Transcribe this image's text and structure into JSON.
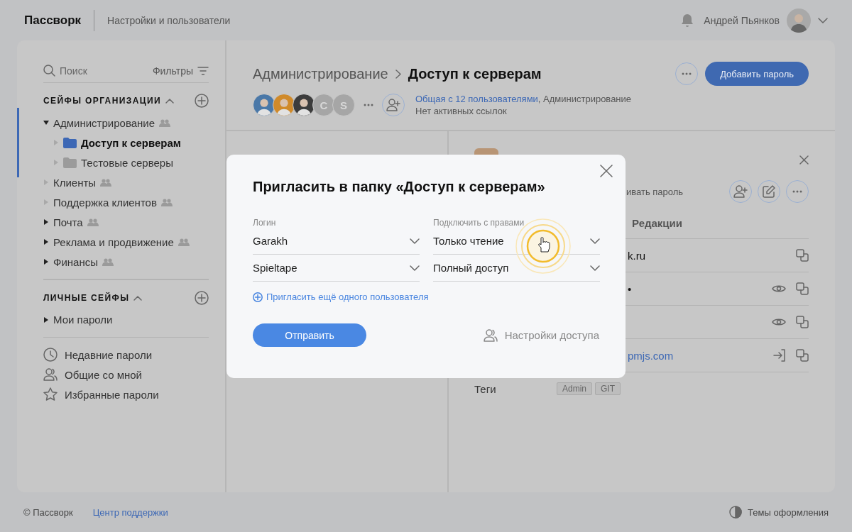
{
  "header": {
    "logo": "Пассворк",
    "section": "Настройки и пользователи",
    "user_name": "Андрей Пьянков"
  },
  "sidebar": {
    "search": {
      "placeholder": "Поиск"
    },
    "filters": "Фильтры",
    "org_vaults": {
      "title": "СЕЙФЫ ОРГАНИЗАЦИИ",
      "expanded": true,
      "items": [
        {
          "label": "Администрирование",
          "expanded": true,
          "empty": false,
          "shared": true,
          "selected": true,
          "children": [
            {
              "label": "Доступ к серверам",
              "expanded": false,
              "empty": true,
              "shared": false,
              "selected": true
            },
            {
              "label": "Тестовые серверы",
              "expanded": false,
              "empty": true,
              "shared": false,
              "selected": false
            }
          ]
        },
        {
          "label": "Клиенты",
          "expanded": false,
          "empty": true,
          "shared": true,
          "selected": false
        },
        {
          "label": "Поддержка клиентов",
          "expanded": false,
          "empty": true,
          "shared": true,
          "selected": false
        },
        {
          "label": "Почта",
          "expanded": false,
          "empty": false,
          "shared": true,
          "selected": false
        },
        {
          "label": "Реклама и продвижение",
          "expanded": false,
          "empty": false,
          "shared": true,
          "selected": false
        },
        {
          "label": "Финансы",
          "expanded": false,
          "empty": false,
          "shared": true,
          "selected": false
        }
      ]
    },
    "personal_vaults": {
      "title": "ЛИЧНЫЕ СЕЙФЫ",
      "expanded": true,
      "items": [
        {
          "label": "Мои пароли",
          "expanded": false,
          "empty": false,
          "shared": false,
          "selected": false
        }
      ]
    },
    "links": [
      {
        "kind": "recent",
        "label": "Недавние пароли"
      },
      {
        "kind": "shared",
        "label": "Общие со мной"
      },
      {
        "kind": "favorites",
        "label": "Избранные пароли"
      }
    ]
  },
  "folder": {
    "breadcrumb": [
      "Администрирование",
      "Доступ к серверам"
    ],
    "add_button": "Добавить пароль",
    "members": [
      {
        "kind": "photo",
        "color": "#4a78a8"
      },
      {
        "kind": "photo",
        "color": "#d08a2a"
      },
      {
        "kind": "photo",
        "color": "#3c3c3c"
      },
      {
        "kind": "letter",
        "label": "C"
      },
      {
        "kind": "letter",
        "label": "S"
      }
    ],
    "shared_link": "Общая с 12 пользователями",
    "shared_rest": ", Администрирование",
    "links_status": "Нет активных ссылок"
  },
  "detail": {
    "hint": "ивать пароль",
    "tab": "Редакции",
    "rows": [
      {
        "kind": "text",
        "value": "k.ru"
      },
      {
        "kind": "password",
        "value": "•"
      },
      {
        "kind": "secret"
      },
      {
        "kind": "url",
        "value": "pmjs.com"
      }
    ],
    "tags_label": "Теги",
    "tags": [
      "Admin",
      "GIT"
    ]
  },
  "modal": {
    "title": "Пригласить в папку «Доступ к серверам»",
    "login_label": "Логин",
    "rights_label": "Подключить с правами",
    "rows": [
      {
        "login": "Garakh",
        "rights": "Только чтение"
      },
      {
        "login": "Spieltape",
        "rights": "Полный доступ"
      }
    ],
    "add_link": "Пригласить ещё одного пользователя",
    "submit": "Отправить",
    "access_settings": "Настройки доступа"
  },
  "footer": {
    "copyright": "© Пассворк",
    "support": "Центр поддержки",
    "themes": "Темы оформления"
  }
}
